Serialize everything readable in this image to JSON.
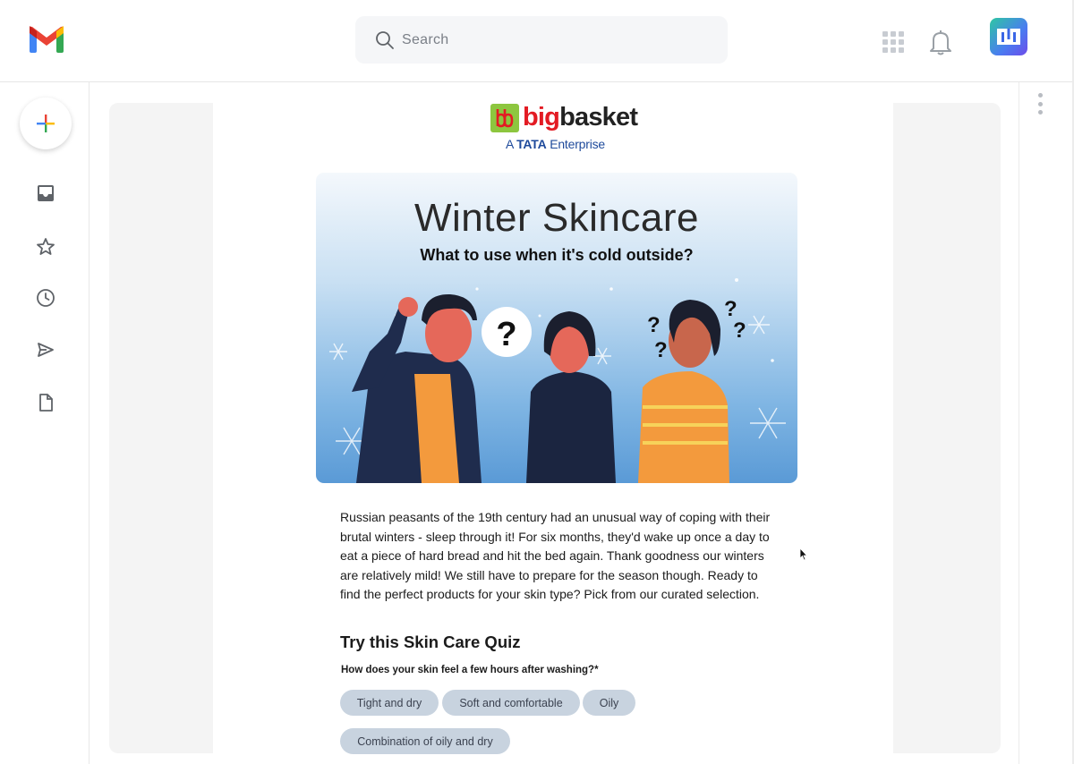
{
  "topbar": {
    "search_placeholder": "Search"
  },
  "email": {
    "brand": {
      "name_red": "big",
      "name_dark": "basket",
      "tagline_prefix": "A",
      "tagline_brand": "TATA",
      "tagline_suffix": "Enterprise"
    },
    "hero": {
      "title": "Winter Skincare",
      "subtitle": "What to use when it's cold outside?"
    },
    "body": "Russian peasants of the 19th century had an unusual way of coping with their brutal winters - sleep through it! For six months, they'd wake up once a day to eat a piece of hard bread and hit the bed again. Thank goodness our winters are relatively mild! We still have to prepare for the season though. Ready to find the perfect products for your skin type? Pick from our curated selection.",
    "quiz": {
      "title": "Try this Skin Care Quiz",
      "question": "How does your skin feel a few hours after washing?*",
      "options": [
        "Tight and dry",
        "Soft and comfortable",
        "Oily",
        "Combination of oily and dry"
      ]
    }
  },
  "colors": {
    "gmail_red": "#ea4335",
    "gmail_blue": "#4285f4",
    "gmail_green": "#34a853",
    "gmail_yellow": "#fbbc04",
    "bigbasket_green": "#8dc63f",
    "bigbasket_red": "#e31b23",
    "tata_blue": "#1e4a9b",
    "chip_bg": "#c8d3df",
    "panel_bg": "#f4f4f4"
  },
  "icons": {
    "logo": "gmail-logo",
    "search": "search-icon",
    "apps": "apps-grid-icon",
    "notifications": "bell-icon",
    "avatar": "user-avatar",
    "compose": "compose-plus-icon",
    "nav": [
      "inbox-icon",
      "star-icon",
      "clock-icon",
      "send-icon",
      "document-icon"
    ],
    "more": "more-vertical-icon"
  }
}
